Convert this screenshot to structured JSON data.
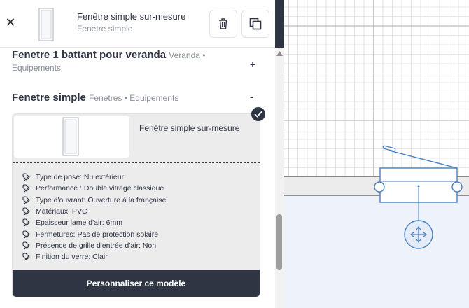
{
  "header": {
    "close_icon": "close-icon",
    "title": "Fenêtre simple sur-mesure",
    "subtitle": "Fenetre simple",
    "trash_icon": "trash-icon",
    "copy_icon": "copy-icon"
  },
  "categories": [
    {
      "name": "Fenetre 1 battant pour veranda",
      "tags": "Veranda • Equipements",
      "toggle": "+"
    },
    {
      "name": "Fenetre simple",
      "tags": "Fenetres • Equipements",
      "toggle": "-"
    }
  ],
  "product": {
    "title": "Fenêtre simple sur-mesure",
    "specs": [
      "Type de pose: Nu extérieur",
      "Performance : Double vitrage classique",
      "Type d'ouvrant: Ouverture à la française",
      "Matériaux: PVC",
      "Epaisseur lame d'air: 6mm",
      "Fermetures: Pas de protection solaire",
      "Présence de grille d'entrée d'air: Non",
      "Finition du verre: Clair"
    ],
    "cta": "Personnaliser ce modèle",
    "selected_icon": "check-icon"
  },
  "colors": {
    "dark": "#2f3542",
    "accent": "#4a7fc1",
    "grid": "#c9c9c9"
  }
}
